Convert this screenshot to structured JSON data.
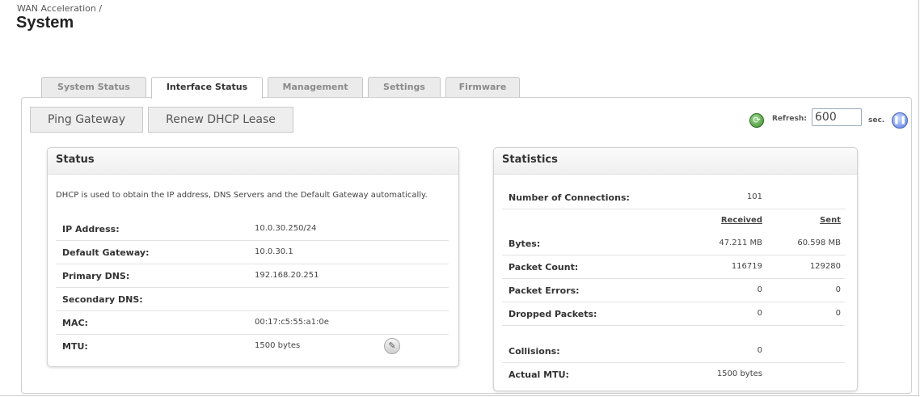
{
  "breadcrumb": "WAN Acceleration /",
  "title": "System",
  "tabs": [
    {
      "label": "System Status",
      "active": false
    },
    {
      "label": "Interface Status",
      "active": true
    },
    {
      "label": "Management",
      "active": false
    },
    {
      "label": "Settings",
      "active": false
    },
    {
      "label": "Firmware",
      "active": false
    }
  ],
  "toolbar": {
    "ping_label": "Ping Gateway",
    "renew_label": "Renew DHCP Lease",
    "refresh_label": "Refresh:",
    "refresh_value": "600",
    "sec_label": "sec."
  },
  "status": {
    "title": "Status",
    "description": "DHCP is used to obtain the IP address, DNS Servers and the Default Gateway automatically.",
    "rows": [
      {
        "label": "IP Address:",
        "value": "10.0.30.250/24"
      },
      {
        "label": "Default Gateway:",
        "value": "10.0.30.1"
      },
      {
        "label": "Primary DNS:",
        "value": "192.168.20.251"
      },
      {
        "label": "Secondary DNS:",
        "value": ""
      },
      {
        "label": "MAC:",
        "value": "00:17:c5:55:a1:0e"
      },
      {
        "label": "MTU:",
        "value": "1500 bytes"
      }
    ]
  },
  "statistics": {
    "title": "Statistics",
    "connections_label": "Number of Connections:",
    "connections_value": "101",
    "received_header": "Received",
    "sent_header": "Sent",
    "rows": [
      {
        "label": "Bytes:",
        "received": "47.211 MB",
        "sent": "60.598 MB"
      },
      {
        "label": "Packet Count:",
        "received": "116719",
        "sent": "129280"
      },
      {
        "label": "Packet Errors:",
        "received": "0",
        "sent": "0"
      },
      {
        "label": "Dropped Packets:",
        "received": "0",
        "sent": "0"
      }
    ],
    "collisions_label": "Collisions:",
    "collisions_value": "0",
    "mtu_label": "Actual MTU:",
    "mtu_value": "1500 bytes"
  }
}
